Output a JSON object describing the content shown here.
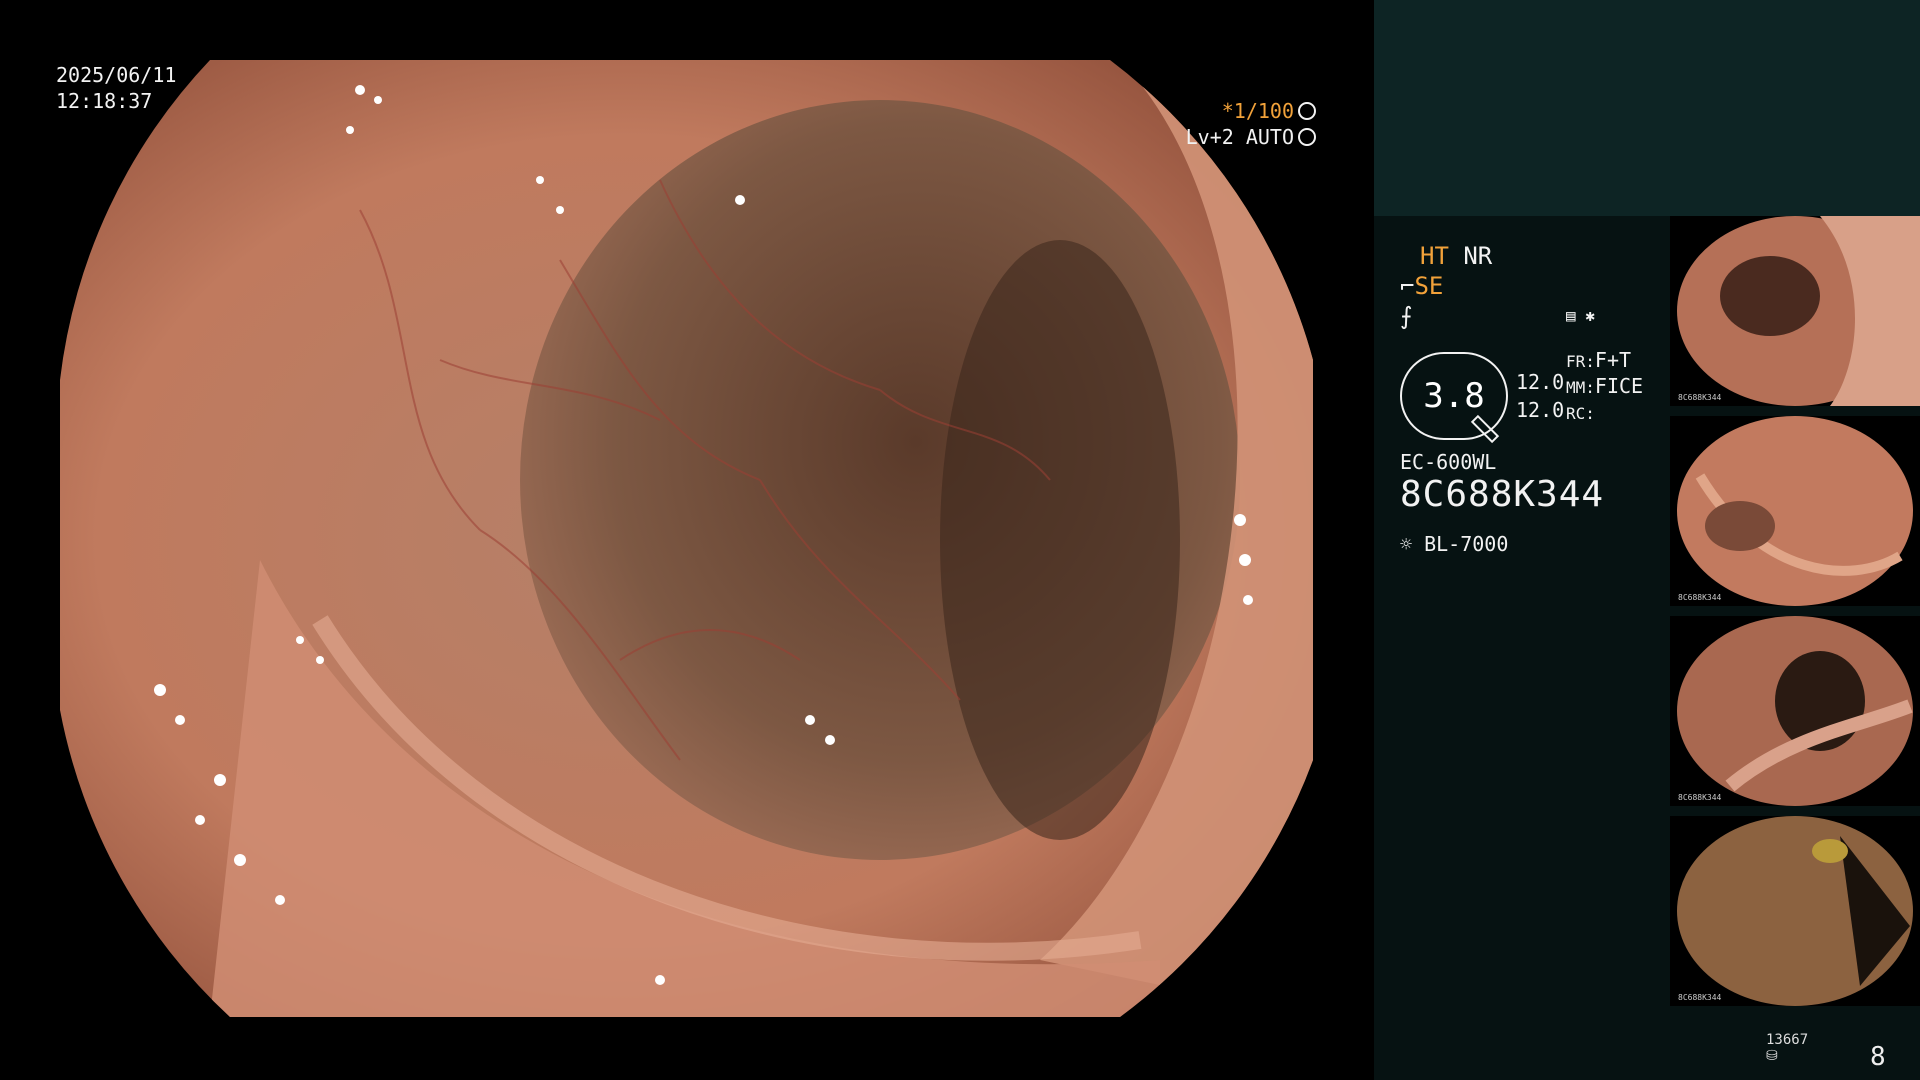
{
  "datetime": {
    "date": "2025/06/11",
    "time": "12:18:37"
  },
  "shutter": {
    "speed": "*1/100",
    "level": "Lv+2 AUTO"
  },
  "panel": {
    "ht": "HT",
    "nr": "NR",
    "se": "SE",
    "zoom": "3.8",
    "val_fr": "12.0",
    "val_rc": "12.0",
    "fr_label": "FR:",
    "fr_value": "F+T",
    "mm_label": "MM:",
    "mm_value": "FICE",
    "rc_label": "RC:",
    "scope_model": "EC-600WL",
    "scope_serial": "8C688K344",
    "light_source": "BL-7000",
    "counter_small": "13667",
    "counter_big": "8"
  },
  "colors": {
    "accent": "#f2a23a",
    "panel_bg": "#061212",
    "panel_top": "#0d2424",
    "tissue": "#c27a5f"
  },
  "thumbnails": [
    {
      "label": "8C688K344"
    },
    {
      "label": "8C688K344"
    },
    {
      "label": "8C688K344"
    },
    {
      "label": "8C688K344"
    }
  ]
}
